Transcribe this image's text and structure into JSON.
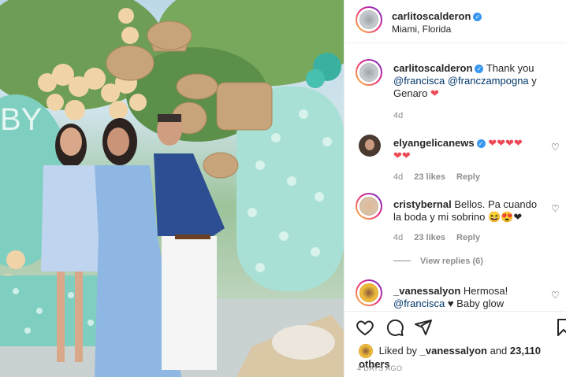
{
  "post": {
    "author": "carlitoscalderon",
    "location": "Miami, Florida"
  },
  "caption": {
    "username": "carlitoscalderon",
    "text_thank": "Thank you",
    "mention1": "@francisca",
    "mention2": "@franczampogna",
    "text_and": "y",
    "text_genaro": "Genaro",
    "heart": "❤",
    "time": "4d"
  },
  "comments": [
    {
      "username": "elyangelicanews",
      "text": "❤❤❤❤\n❤❤",
      "time": "4d",
      "likes": "23 likes",
      "reply": "Reply"
    },
    {
      "username": "cristybernal",
      "text": "Bellos. Pa cuando la boda y mi sobrino 😆😍❤",
      "time": "4d",
      "likes": "23 likes",
      "reply": "Reply",
      "view_replies": "View replies (6)"
    },
    {
      "username": "_vanessalyon",
      "text": "Hermosa!",
      "mention": "@francisca",
      "text2": "♥ Baby glow"
    }
  ],
  "likes": {
    "prefix": "Liked by",
    "user": "_vanessalyon",
    "and": "and",
    "count": "23,110 others"
  },
  "timeago": "4 DAYS AGO",
  "colors": {
    "verified": "#3897f0",
    "heart": "#ed4956",
    "mention": "#00376b",
    "meta": "#8e8e8e"
  }
}
